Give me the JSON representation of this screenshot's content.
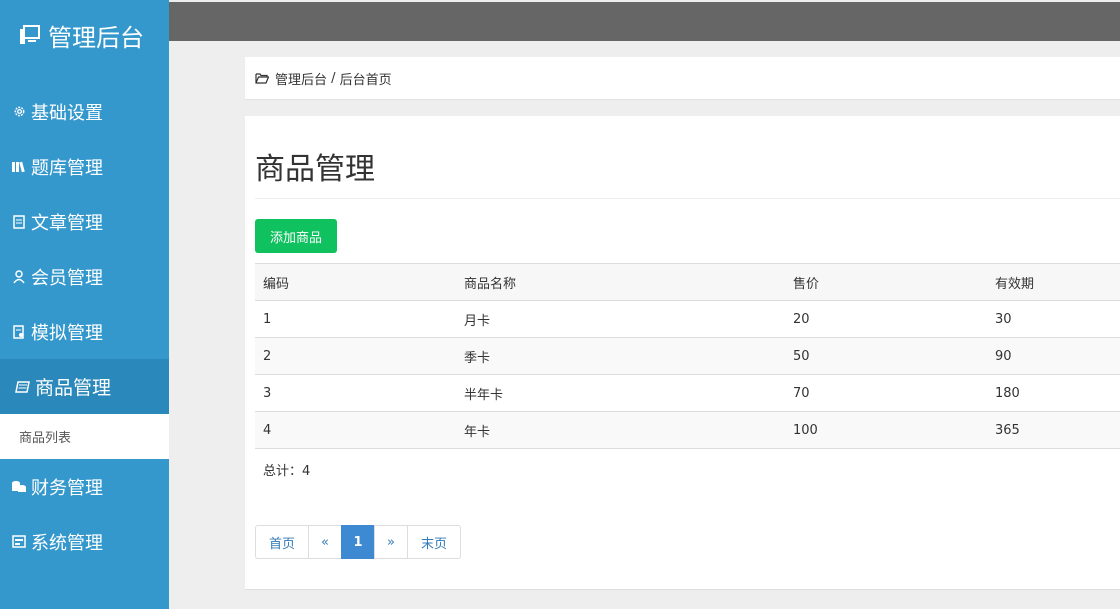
{
  "sidebar": {
    "brand": "管理后台",
    "items": [
      {
        "label": "基础设置",
        "icon": "gear-icon"
      },
      {
        "label": "题库管理",
        "icon": "books-icon"
      },
      {
        "label": "文章管理",
        "icon": "article-icon"
      },
      {
        "label": "会员管理",
        "icon": "user-icon"
      },
      {
        "label": "模拟管理",
        "icon": "exam-icon"
      },
      {
        "label": "商品管理",
        "icon": "product-icon"
      },
      {
        "label": "财务管理",
        "icon": "finance-icon"
      },
      {
        "label": "系统管理",
        "icon": "system-icon"
      }
    ],
    "submenu": [
      "商品列表"
    ]
  },
  "breadcrumb": {
    "root": "管理后台",
    "sep": " / ",
    "current": "后台首页"
  },
  "main": {
    "title": "商品管理",
    "add_button": "添加商品",
    "table": {
      "headers": [
        "编码",
        "商品名称",
        "售价",
        "有效期"
      ],
      "rows": [
        [
          "1",
          "月卡",
          "20",
          "30"
        ],
        [
          "2",
          "季卡",
          "50",
          "90"
        ],
        [
          "3",
          "半年卡",
          "70",
          "180"
        ],
        [
          "4",
          "年卡",
          "100",
          "365"
        ]
      ]
    },
    "total": "总计：4"
  },
  "pagination": {
    "first": "首页",
    "prev": "«",
    "current": "1",
    "next": "»",
    "last": "末页"
  },
  "colors": {
    "sidebar": "#3598cd",
    "sidebar_active": "#2b88ba",
    "topbar": "#666666",
    "add_button": "#0fc15f",
    "page_current": "#3d8ad3"
  }
}
